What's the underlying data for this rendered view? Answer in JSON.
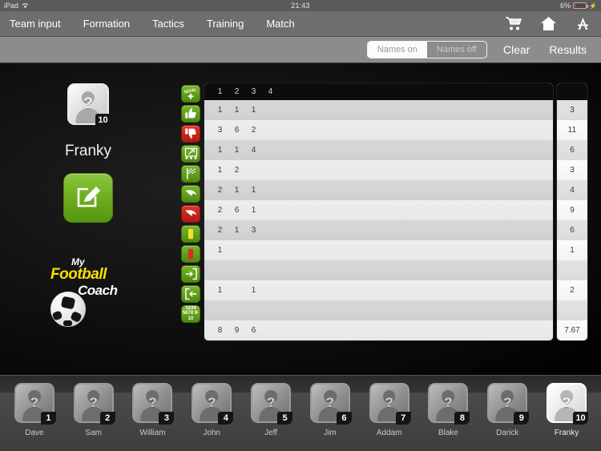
{
  "statusbar": {
    "device": "iPad",
    "wifi_icon": "wifi-icon",
    "time": "21:43",
    "battery_pct": "6%",
    "battery_icon": "battery-icon"
  },
  "navbar": {
    "items": [
      {
        "label": "Team input"
      },
      {
        "label": "Formation"
      },
      {
        "label": "Tactics"
      },
      {
        "label": "Training"
      },
      {
        "label": "Match"
      }
    ],
    "icons": [
      {
        "name": "shopping-cart-icon"
      },
      {
        "name": "home-icon"
      },
      {
        "name": "app-store-icon"
      }
    ]
  },
  "toolbar": {
    "segment": {
      "on_label": "Names on",
      "off_label": "Names off",
      "selected": "Names on"
    },
    "clear_label": "Clear",
    "results_label": "Results"
  },
  "selected_player": {
    "name": "Franky",
    "number": "10",
    "edit_icon": "edit-note-icon"
  },
  "logo": {
    "line1": "My",
    "line2": "Football",
    "line3": "Coach",
    "ball_icon": "football-icon"
  },
  "stats_table": {
    "columns": [
      "1",
      "2",
      "3",
      "4"
    ],
    "rows": [
      {
        "icon": "goal-plus-icon",
        "icon_color": "green",
        "icon_label": "GOAL+",
        "values": [
          "1",
          "1",
          "1",
          ""
        ],
        "total": "3"
      },
      {
        "icon": "thumbs-up-icon",
        "icon_color": "green",
        "icon_label": "",
        "values": [
          "3",
          "6",
          "2",
          ""
        ],
        "total": "11"
      },
      {
        "icon": "thumbs-down-icon",
        "icon_color": "red",
        "icon_label": "",
        "values": [
          "1",
          "1",
          "4",
          ""
        ],
        "total": "6"
      },
      {
        "icon": "pass-diagram-icon",
        "icon_color": "green",
        "icon_label": "",
        "values": [
          "1",
          "2",
          "",
          ""
        ],
        "total": "3"
      },
      {
        "icon": "corner-flag-icon",
        "icon_color": "green",
        "icon_label": "",
        "values": [
          "2",
          "1",
          "1",
          ""
        ],
        "total": "4"
      },
      {
        "icon": "shot-on-icon",
        "icon_color": "green",
        "icon_label": "",
        "values": [
          "2",
          "6",
          "1",
          ""
        ],
        "total": "9"
      },
      {
        "icon": "shot-off-icon",
        "icon_color": "red",
        "icon_label": "",
        "values": [
          "2",
          "1",
          "3",
          ""
        ],
        "total": "6"
      },
      {
        "icon": "yellow-card-icon",
        "icon_color": "green",
        "icon_label": "",
        "values": [
          "1",
          "",
          "",
          ""
        ],
        "total": "1"
      },
      {
        "icon": "red-card-icon",
        "icon_color": "green",
        "icon_label": "",
        "values": [
          "",
          "",
          "",
          ""
        ],
        "total": ""
      },
      {
        "icon": "sub-on-icon",
        "icon_color": "green",
        "icon_label": "",
        "values": [
          "1",
          "",
          "1",
          ""
        ],
        "total": "2"
      },
      {
        "icon": "sub-off-icon",
        "icon_color": "green",
        "icon_label": "",
        "values": [
          "",
          "",
          "",
          ""
        ],
        "total": ""
      },
      {
        "icon": "rating-scale-icon",
        "icon_color": "green",
        "icon_label": "1234 5678 9-10",
        "values": [
          "8",
          "9",
          "6",
          ""
        ],
        "total": "7.67"
      }
    ]
  },
  "squad": [
    {
      "name": "Dave",
      "number": "1",
      "selected": false
    },
    {
      "name": "Sam",
      "number": "2",
      "selected": false
    },
    {
      "name": "William",
      "number": "3",
      "selected": false
    },
    {
      "name": "John",
      "number": "4",
      "selected": false
    },
    {
      "name": "Jeff",
      "number": "5",
      "selected": false
    },
    {
      "name": "Jim",
      "number": "6",
      "selected": false
    },
    {
      "name": "Addam",
      "number": "7",
      "selected": false
    },
    {
      "name": "Blake",
      "number": "8",
      "selected": false
    },
    {
      "name": "Darick",
      "number": "9",
      "selected": false
    },
    {
      "name": "Franky",
      "number": "10",
      "selected": true
    }
  ],
  "colors": {
    "accent_green": "#6fae20",
    "accent_red": "#d0241a",
    "navbar": "#6e6e6e",
    "toolbar": "#8c8c8c"
  }
}
